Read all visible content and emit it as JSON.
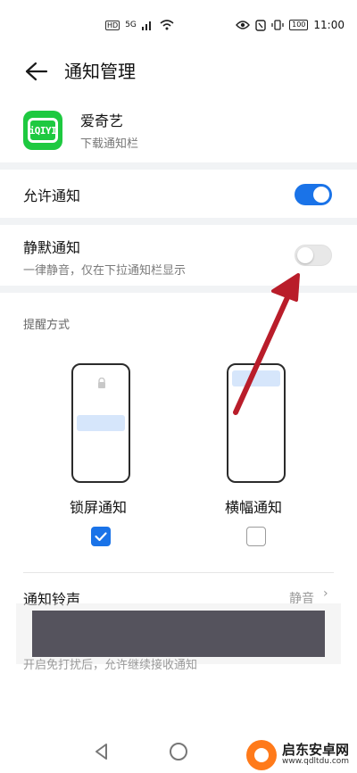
{
  "status_bar": {
    "net_type": "HD",
    "signal_label": "5G",
    "battery": "100",
    "time": "11:00"
  },
  "header": {
    "title": "通知管理"
  },
  "app": {
    "name": "爱奇艺",
    "subtitle": "下载通知栏",
    "icon_text": "iQIYI"
  },
  "settings": {
    "allow_notifications": {
      "label": "允许通知",
      "enabled": true
    },
    "silent_notifications": {
      "label": "静默通知",
      "desc": "一律静音，仅在下拉通知栏显示",
      "enabled": false
    }
  },
  "reminder": {
    "section_title": "提醒方式",
    "modes": [
      {
        "label": "锁屏通知",
        "checked": true
      },
      {
        "label": "横幅通知",
        "checked": false
      }
    ]
  },
  "ringtone": {
    "label": "通知铃声",
    "value": "静音"
  },
  "dnd_desc": "开启免打扰后，允许继续接收通知",
  "watermark": {
    "title": "启东安卓网",
    "url": "www.qdltdu.com"
  },
  "colors": {
    "accent": "#1a73e8",
    "app_green": "#1ec940",
    "arrow_red": "#c8202a"
  }
}
